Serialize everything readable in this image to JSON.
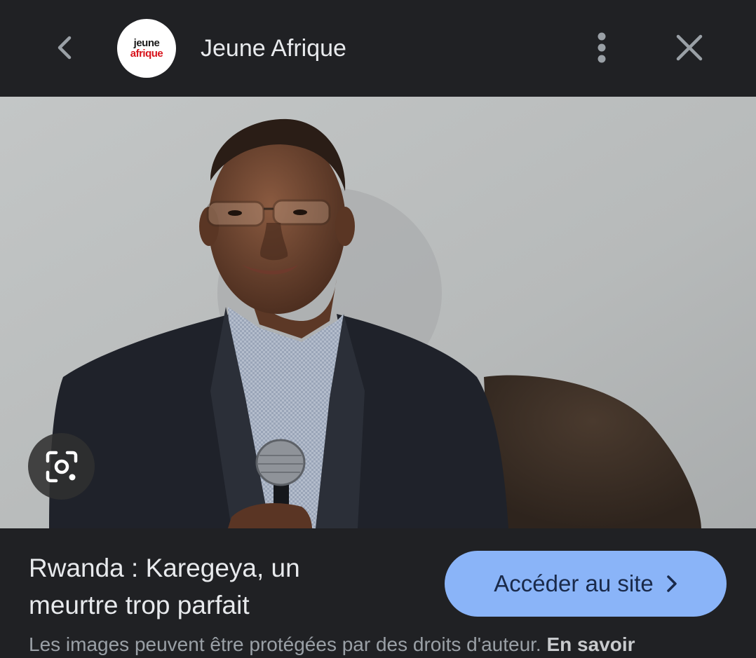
{
  "header": {
    "site_name": "Jeune Afrique",
    "logo_line1": "jeune",
    "logo_line2": "afrique",
    "icons": {
      "back": "chevron-left-icon",
      "more": "more-vertical-icon",
      "close": "close-icon"
    }
  },
  "image": {
    "lens_icon": "lens-search-icon"
  },
  "result": {
    "title": "Rwanda : Karegeya, un meurtre trop parfait",
    "visit_button_label": "Accéder au site",
    "disclaimer_text": "Les images peuvent être protégées par des droits d'auteur.",
    "learn_more_label": "En savoir"
  },
  "colors": {
    "background": "#202124",
    "text_primary": "#e8eaed",
    "text_secondary": "#9aa0a6",
    "accent_button": "#8ab4f8",
    "logo_red": "#d8141c"
  }
}
